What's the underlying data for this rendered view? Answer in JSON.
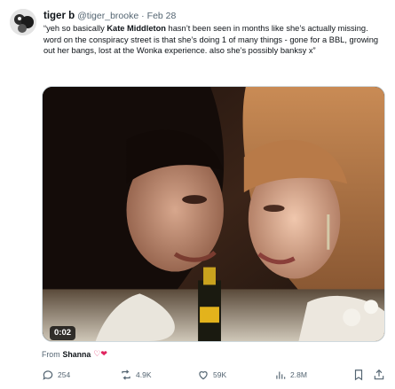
{
  "tweet": {
    "author_name": "tiger b",
    "handle": "@tiger_brooke",
    "separator": "·",
    "date": "Feb 28",
    "text_before": "“yeh so basically ",
    "text_bold": "Kate Middleton",
    "text_after": " hasn’t been seen in months like she’s actually missing. word on the conspiracy street is that she’s doing 1 of many things - gone for a BBL, growing out her bangs, lost at the Wonka experience. also she’s possibly banksy x”",
    "media": {
      "duration": "0:02"
    },
    "from": {
      "label": "From",
      "source": "Shanna",
      "emoji": "♡❤"
    },
    "actions": {
      "replies": "254",
      "retweets": "4.9K",
      "likes": "59K",
      "views": "2.8M"
    }
  },
  "icons": [
    "avatar",
    "reply-icon",
    "retweet-icon",
    "like-icon",
    "views-icon",
    "bookmark-icon",
    "share-icon"
  ]
}
